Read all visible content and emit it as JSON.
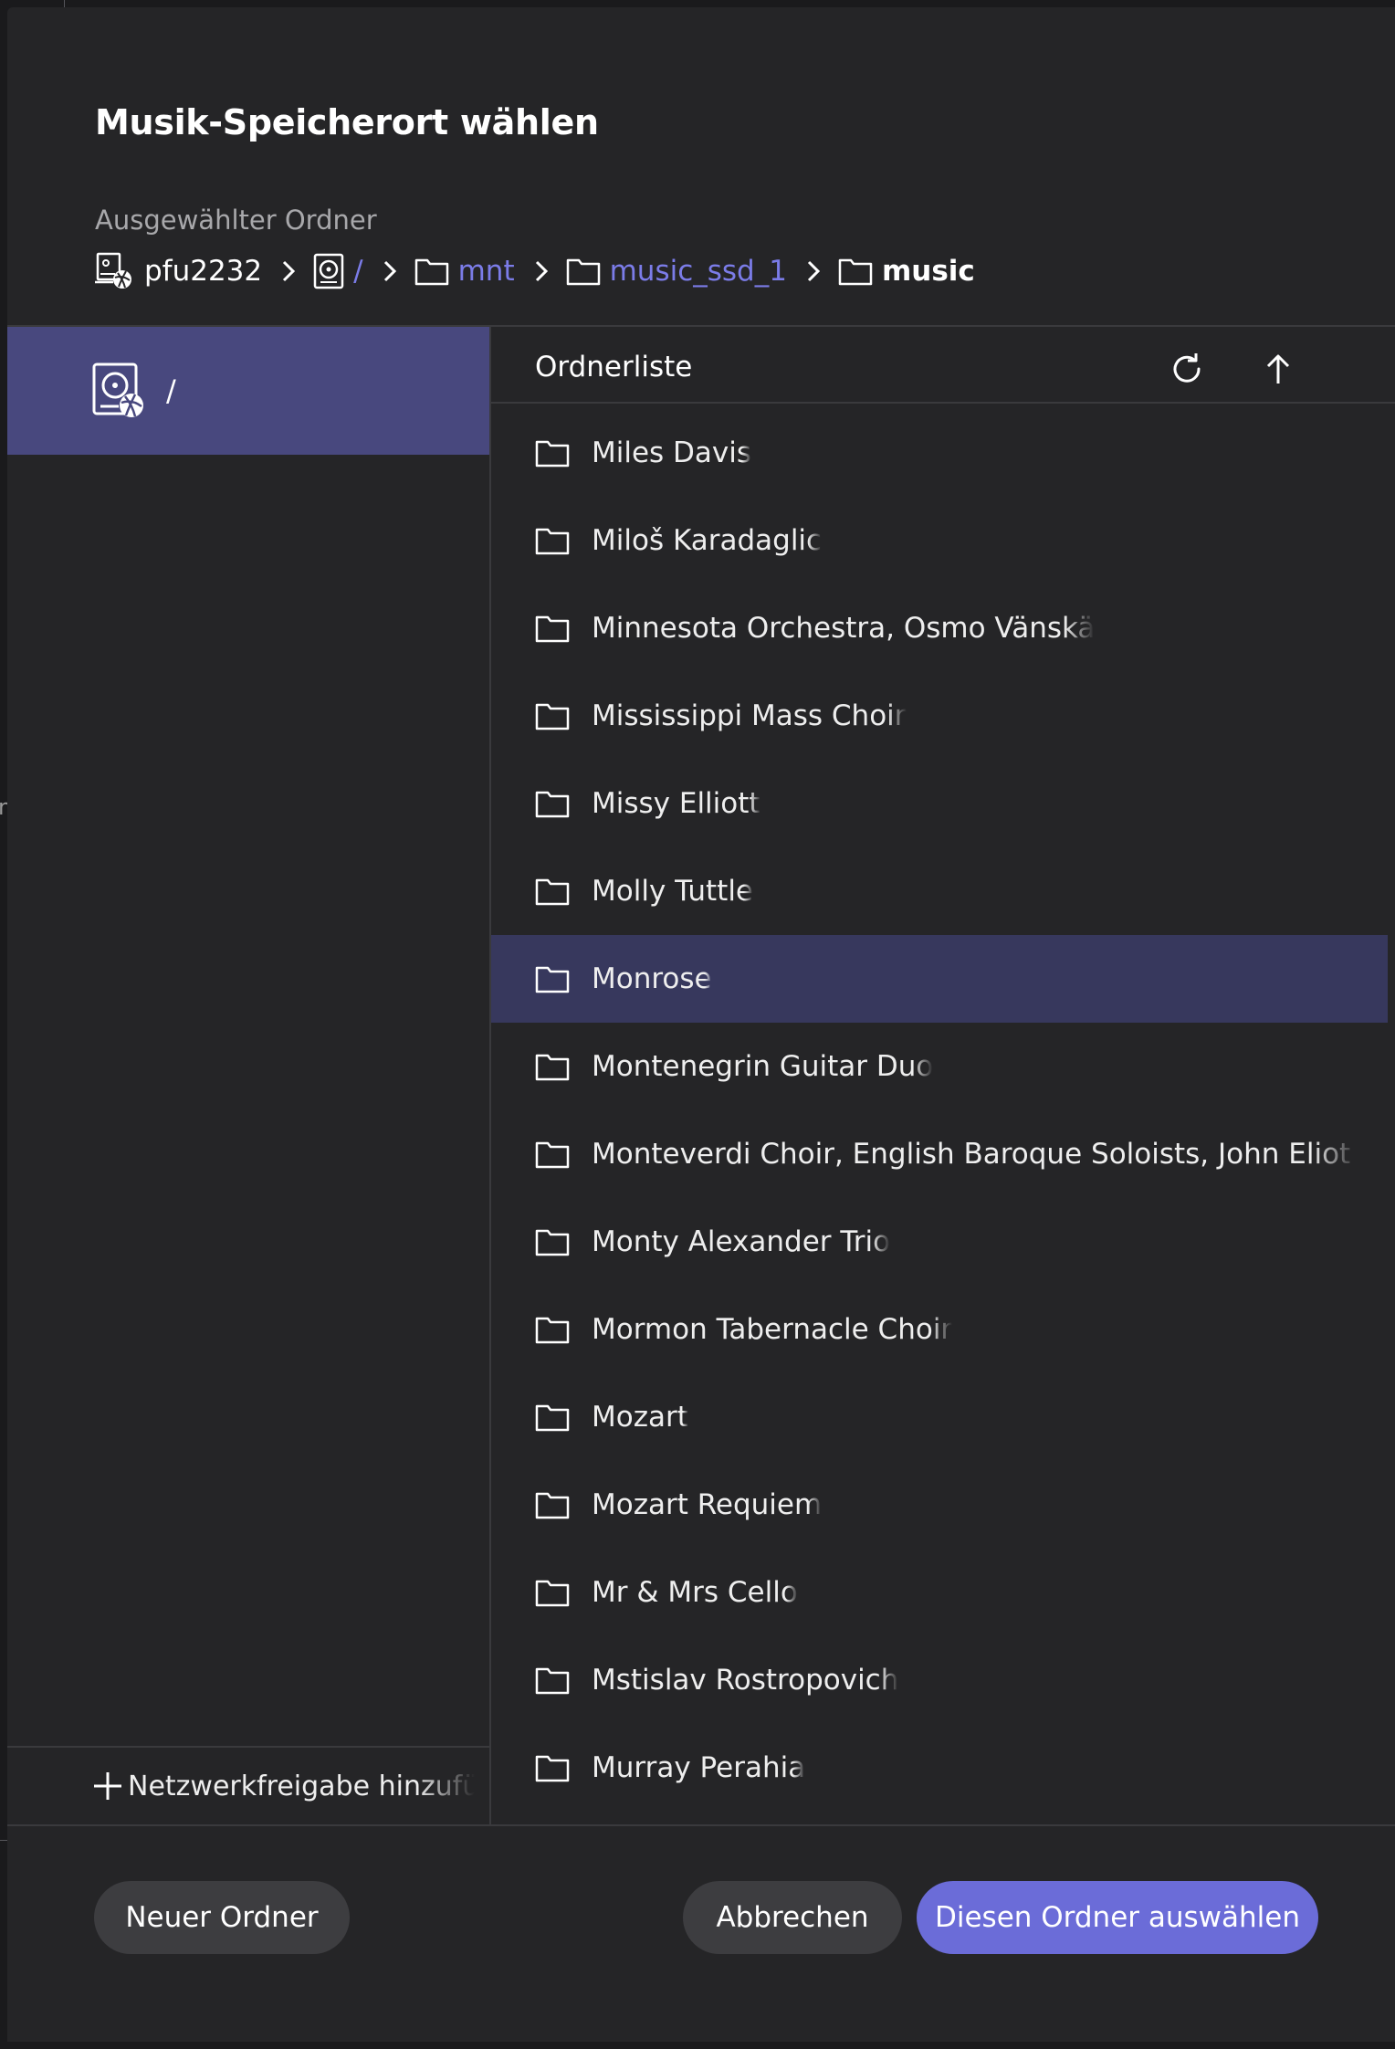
{
  "dialog": {
    "title": "Musik-Speicherort wählen",
    "subtitle": "Ausgewählter Ordner"
  },
  "breadcrumb": [
    {
      "label": "pfu2232",
      "icon": "server-icon"
    },
    {
      "label": "/",
      "icon": "drive-icon"
    },
    {
      "label": "mnt",
      "icon": "folder-icon"
    },
    {
      "label": "music_ssd_1",
      "icon": "folder-icon"
    },
    {
      "label": "music",
      "icon": "folder-icon"
    }
  ],
  "sidebar": {
    "selected_label": "/",
    "selected_icon": "network-drive-icon",
    "add_share_label": "Netzwerkfreigabe hinzufü"
  },
  "folder_list": {
    "header": "Ordnerliste",
    "refresh_icon": "refresh-icon",
    "up_icon": "arrow-up-icon",
    "items": [
      "Miles Davis",
      "Miloš Karadaglic",
      "Minnesota Orchestra, Osmo Vänskä",
      "Mississippi Mass Choir",
      "Missy Elliott",
      "Molly Tuttle",
      "Monrose",
      "Montenegrin Guitar Duo",
      "Monteverdi Choir, English Baroque Soloists, John Eliot Gardiner",
      "Monty Alexander Trio",
      "Mormon Tabernacle Choir",
      "Mozart",
      "Mozart Requiem",
      "Mr & Mrs Cello",
      "Mstislav Rostropovich",
      "Murray Perahia"
    ],
    "selected": "Monrose"
  },
  "footer": {
    "new_folder": "Neuer Ordner",
    "cancel": "Abbrechen",
    "choose": "Diesen Ordner auswählen"
  },
  "colors": {
    "accent": "#6b6cd8",
    "link": "#7b7ce8",
    "sidebar_selected": "#48487e",
    "list_selected": "#37385d",
    "dialog_bg": "#252527"
  },
  "backdrop_text": "n"
}
